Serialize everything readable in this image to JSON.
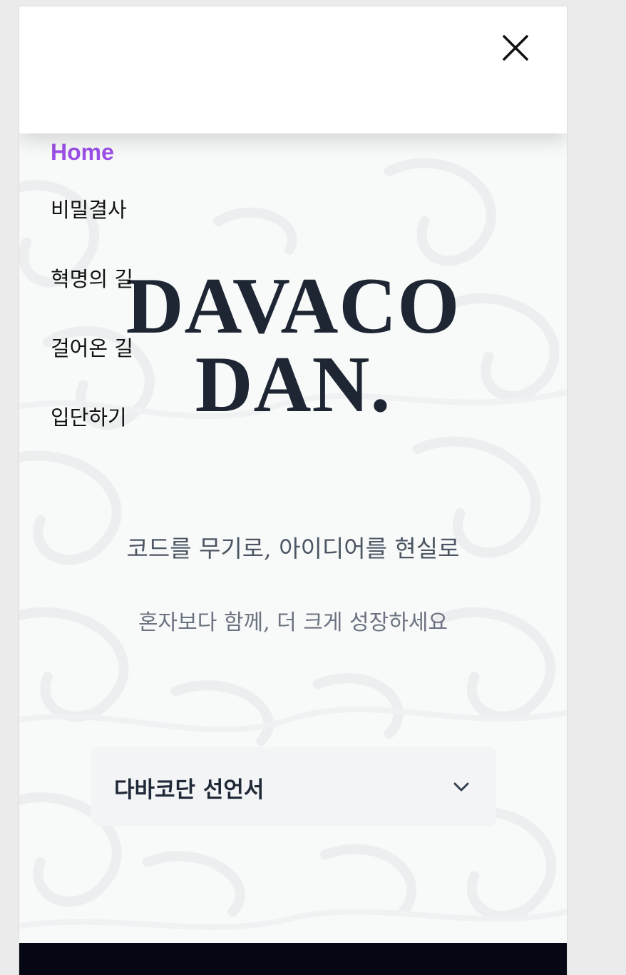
{
  "nav": {
    "items": [
      {
        "label": "Home",
        "active": true
      },
      {
        "label": "비밀결사",
        "active": false
      },
      {
        "label": "혁명의 길",
        "active": false
      },
      {
        "label": "걸어온 길",
        "active": false
      },
      {
        "label": "입단하기",
        "active": false
      }
    ],
    "active_color": "#9b4fe6"
  },
  "hero": {
    "brand_line1": "DAVACO",
    "brand_line2": "DAN.",
    "tagline": "코드를 무기로, 아이디어를 현실로",
    "subtagline": "혼자보다 함께, 더 크게 성장하세요"
  },
  "accordion": {
    "title": "다바코단 선언서",
    "expanded": false,
    "icon": "chevron-down-icon"
  },
  "header": {
    "close_icon": "close-icon"
  },
  "colors": {
    "brand_text": "#1e2634",
    "footer": "#050814",
    "page_background": "#ebebeb"
  }
}
